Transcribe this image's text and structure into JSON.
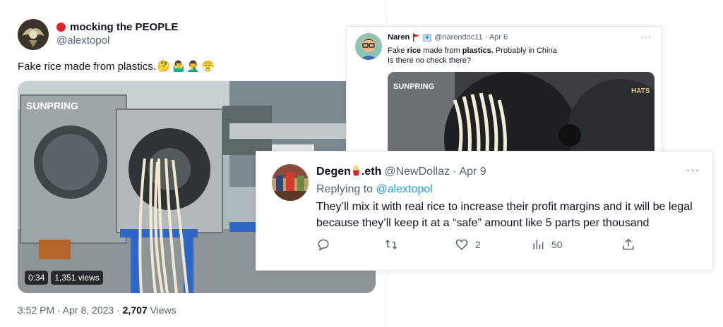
{
  "main_tweet": {
    "display_name": "mocking the PEOPLE",
    "handle": "@alextopol",
    "text": "Fake rice made from plastics.",
    "emojis": [
      "🤔",
      "🤷‍♂️",
      "🤦‍♂️",
      "😤"
    ],
    "video": {
      "watermark": "SUNPRING",
      "duration": "0:34",
      "views_label": "1,351 views"
    },
    "time": "3:52 PM · Apr 8, 2023 ·",
    "views_count": "2,707",
    "views_label": "Views"
  },
  "quoted_tweet": {
    "display_name": "Naren",
    "handle": "@narendoc11 · Apr 6",
    "more": "···",
    "text_part1": "Fake ",
    "text_bold1": "rice",
    "text_part2": " made from ",
    "text_bold2": "plastics.",
    "text_part3": " Probably in China",
    "text_line2": "Is there no check there?",
    "video": {
      "watermark": "SUNPRING",
      "logo": "HATS"
    }
  },
  "reply_tweet": {
    "display_name_prefix": "Degen",
    "display_name_suffix": ".eth",
    "handle_date": "@NewDollaz · Apr 9",
    "more": "···",
    "replying_prefix": "Replying to ",
    "replying_handle": "@alextopol",
    "text": "They’ll mix it with real rice to increase their profit margins and it will be legal because they’ll keep it at a “safe” amount like 5 parts per thousand",
    "actions": {
      "reply": {
        "icon": "reply-icon",
        "count": ""
      },
      "retweet": {
        "icon": "retweet-icon",
        "count": ""
      },
      "like": {
        "icon": "heart-icon",
        "count": "2"
      },
      "views": {
        "icon": "views-icon",
        "count": "50"
      },
      "share": {
        "icon": "share-icon",
        "count": ""
      }
    }
  },
  "colors": {
    "link": "#1d9bf0",
    "muted": "#536471",
    "text": "#0f1419",
    "red_dot": "#e0242a"
  }
}
